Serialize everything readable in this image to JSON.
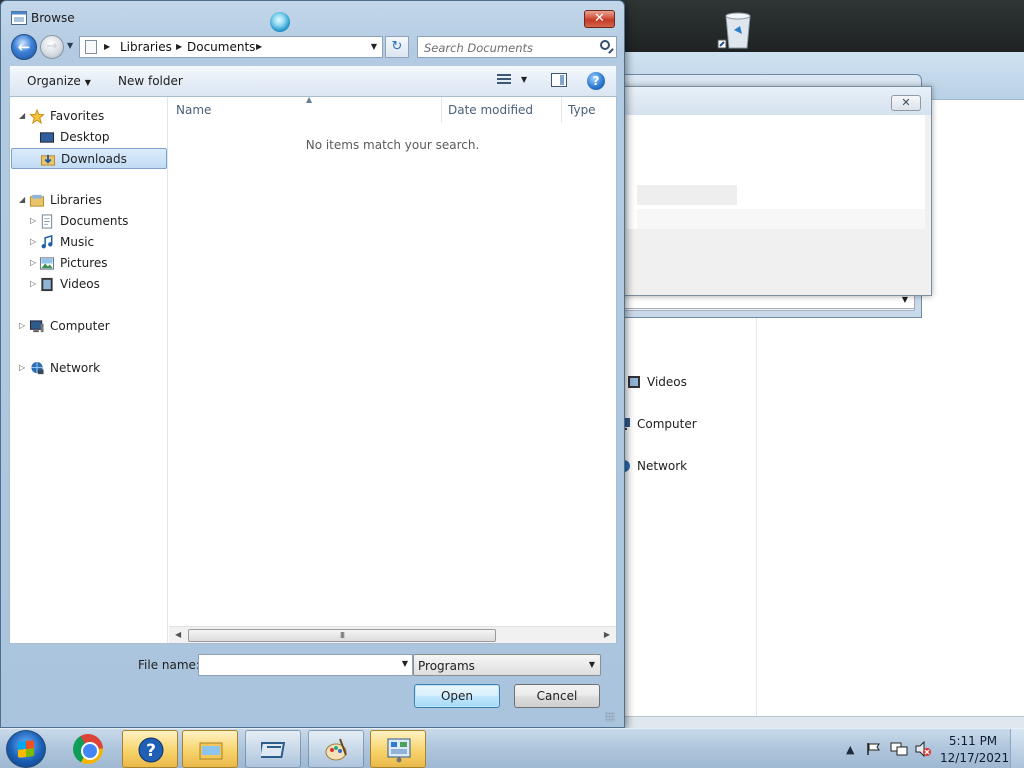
{
  "dialog": {
    "title": "Browse",
    "close_label": "✕",
    "breadcrumb": [
      "Libraries",
      "Documents"
    ],
    "search_placeholder": "Search Documents",
    "toolbar": {
      "organize": "Organize",
      "new_folder": "New folder",
      "help": "?"
    },
    "nav": {
      "favorites": "Favorites",
      "desktop": "Desktop",
      "downloads": "Downloads",
      "libraries": "Libraries",
      "documents": "Documents",
      "music": "Music",
      "pictures": "Pictures",
      "videos": "Videos",
      "computer": "Computer",
      "network": "Network"
    },
    "columns": {
      "name": "Name",
      "date_modified": "Date modified",
      "type": "Type"
    },
    "empty_message": "No items match your search.",
    "scroll_thumb": "III",
    "file_name_label": "File name:",
    "file_name_value": "",
    "file_type": "Programs",
    "open_label": "Open",
    "cancel_label": "Cancel"
  },
  "background": {
    "close_label": "✕",
    "nav": {
      "videos": "Videos",
      "computer": "Computer",
      "network": "Network"
    }
  },
  "taskbar": {
    "time": "5:11 PM",
    "date": "12/17/2021"
  },
  "colors": {
    "selection": "#c1dcf5",
    "accent": "#3c7fb1",
    "close_red": "#c23a24",
    "taskbar": "#b0c7dd"
  }
}
